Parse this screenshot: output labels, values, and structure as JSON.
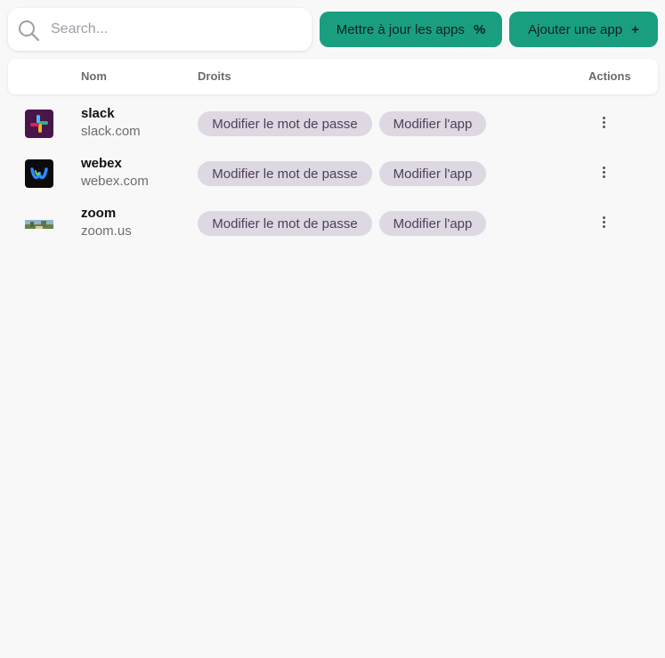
{
  "search": {
    "placeholder": "Search..."
  },
  "toolbar": {
    "update_label": "Mettre à jour les apps",
    "update_icon": "percent-icon",
    "add_label": "Ajouter une app",
    "add_icon": "plus-icon"
  },
  "table": {
    "columns": {
      "name": "Nom",
      "rights": "Droits",
      "actions": "Actions"
    },
    "rows": [
      {
        "name": "slack",
        "domain": "slack.com",
        "logo": "slack-logo",
        "rights": [
          "Modifier le mot de passe",
          "Modifier l'app"
        ]
      },
      {
        "name": "webex",
        "domain": "webex.com",
        "logo": "webex-logo",
        "rights": [
          "Modifier le mot de passe",
          "Modifier l'app"
        ]
      },
      {
        "name": "zoom",
        "domain": "zoom.us",
        "logo": "zoom-logo",
        "rights": [
          "Modifier le mot de passe",
          "Modifier l'app"
        ]
      }
    ]
  },
  "colors": {
    "accent": "#1a9e80",
    "chip_bg": "#ddd8e1",
    "chip_text": "#4d3f5c",
    "background": "#f8f8f8"
  }
}
